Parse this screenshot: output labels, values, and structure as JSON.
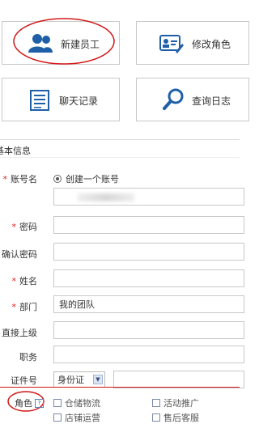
{
  "tiles": [
    {
      "label": "新建员工",
      "icon": "users-icon"
    },
    {
      "label": "修改角色",
      "icon": "id-card-edit-icon"
    },
    {
      "label": "聊天记录",
      "icon": "document-list-icon"
    },
    {
      "label": "查询日志",
      "icon": "magnifier-icon"
    }
  ],
  "section": {
    "title": "基本信息"
  },
  "form": {
    "account_label": "账号名",
    "account_option": "创建一个账号",
    "password_label": "密码",
    "confirm_label": "确认密码",
    "name_label": "姓名",
    "dept_label": "部门",
    "dept_value": "我的团队",
    "supervisor_label": "直接上级",
    "position_label": "职务",
    "id_label": "证件号",
    "id_type": "身份证",
    "role_label": "角色",
    "role_help": "?",
    "roles": [
      "仓储物流",
      "活动推广",
      "店铺运营",
      "售后客服"
    ]
  },
  "colors": {
    "accent": "#1f5fa8",
    "required": "#e02020",
    "annotation": "#d01818"
  }
}
